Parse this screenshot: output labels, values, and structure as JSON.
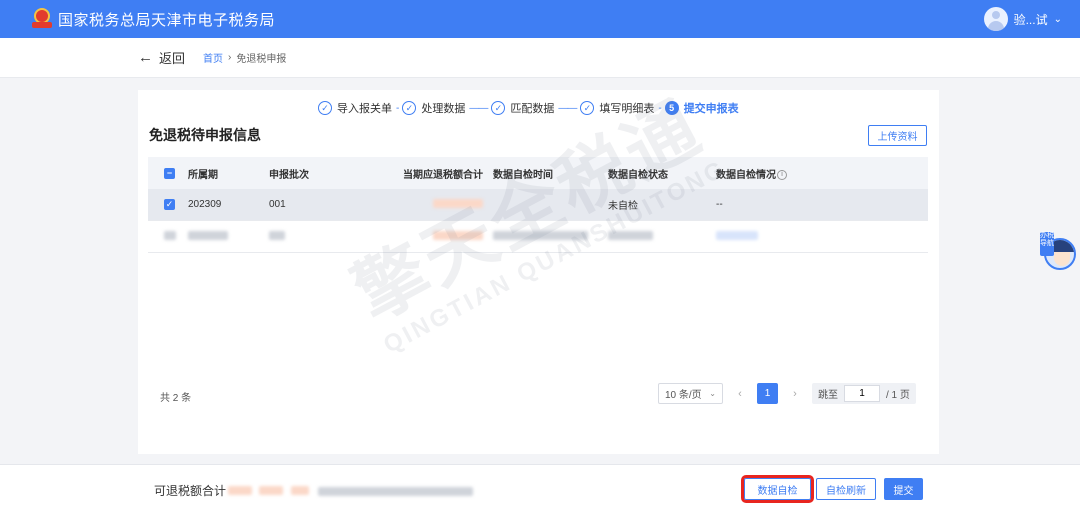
{
  "header": {
    "title": "国家税务总局天津市电子税务局",
    "user_name": "验...试"
  },
  "breadcrumb": {
    "back_label": "返回",
    "home": "首页",
    "separator": "›",
    "current": "免退税申报"
  },
  "steps": [
    {
      "label": "导入报关单",
      "status": "done"
    },
    {
      "label": "处理数据",
      "status": "done"
    },
    {
      "label": "匹配数据",
      "status": "done"
    },
    {
      "label": "填写明细表",
      "status": "done"
    },
    {
      "label": "提交申报表",
      "status": "active",
      "number": "5"
    }
  ],
  "section": {
    "title": "免退税待申报信息",
    "upload_button": "上传资料"
  },
  "table": {
    "columns": [
      "所属期",
      "申报批次",
      "当期应退税额合计",
      "数据自检时间",
      "数据自检状态",
      "数据自检情况"
    ],
    "rows": [
      {
        "period": "202309",
        "batch": "001",
        "status": "未自检",
        "detail": "--",
        "checked": true
      }
    ]
  },
  "pagination": {
    "total": "共 2 条",
    "page_size": "10 条/页",
    "current_page": "1",
    "jump_label": "跳至",
    "jump_value": "1",
    "total_pages": "/ 1 页"
  },
  "watermark": {
    "cn": "擎天全税通",
    "en": "QINGTIAN QUANSHUITONG"
  },
  "mascot": {
    "tag": "办税导航"
  },
  "bottom": {
    "sum_label": "可退税额合计",
    "self_check_button": "数据自检",
    "refresh_button": "自检刷新",
    "submit_button": "提交"
  },
  "colors": {
    "primary": "#3f7ef3",
    "highlight": "#e8251f"
  }
}
